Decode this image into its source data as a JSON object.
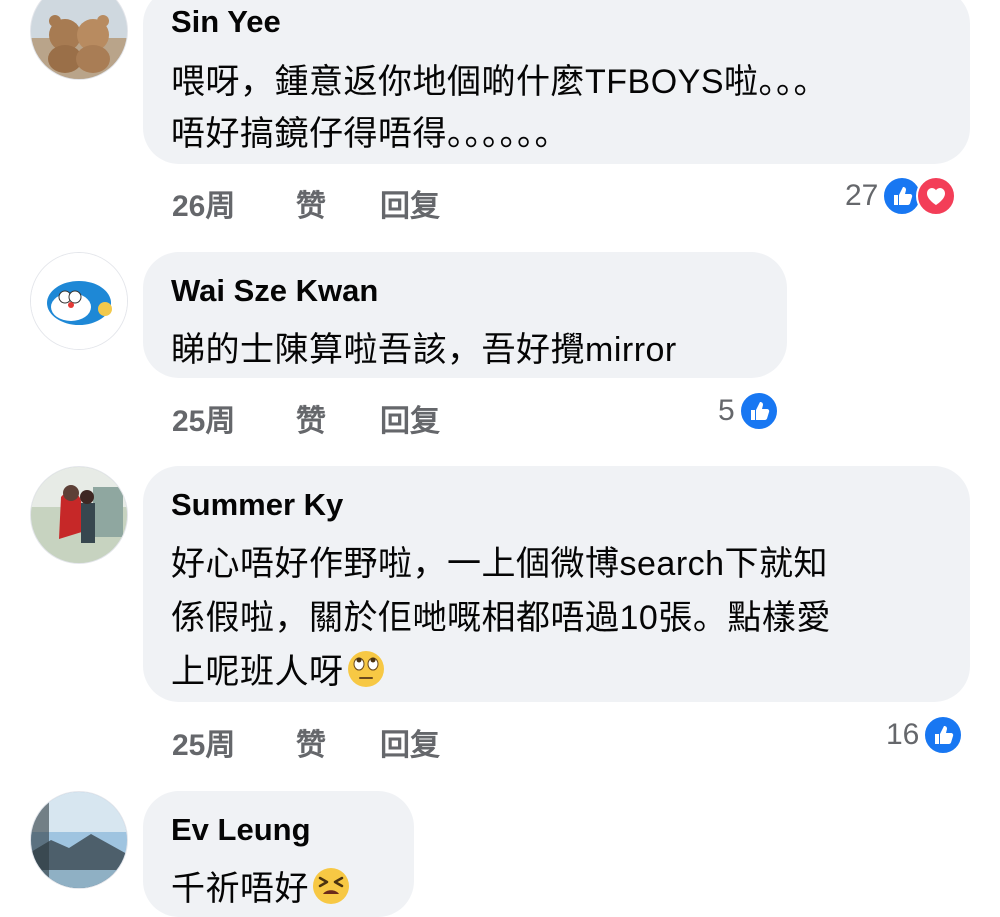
{
  "comments": [
    {
      "author": "Sin Yee",
      "lines": [
        "喂呀，鍾意返你地個啲什麼TFBOYS啦。。。",
        "唔好搞鏡仔得唔得。。。。。。"
      ],
      "time": "26周",
      "like_label": "赞",
      "reply_label": "回复",
      "reaction_count": "27",
      "reactions": [
        "like-icon",
        "love-icon"
      ],
      "avatar": "teddy-bears-avatar"
    },
    {
      "author": "Wai Sze Kwan",
      "lines": [
        "睇的士陳算啦吾該，吾好攪mirror"
      ],
      "time": "25周",
      "like_label": "赞",
      "reply_label": "回复",
      "reaction_count": "5",
      "reactions": [
        "like-icon"
      ],
      "avatar": "doraemon-avatar"
    },
    {
      "author": "Summer Ky",
      "lines": [
        "好心唔好作野啦，一上個微博search下就知",
        "係假啦，關於佢哋嘅相都唔過10張。點樣愛",
        "上呢班人呀"
      ],
      "time": "25周",
      "like_label": "赞",
      "reply_label": "回复",
      "reaction_count": "16",
      "reactions": [
        "like-icon"
      ],
      "avatar": "couple-photo-avatar",
      "trailing_emoji": "eye-roll-emoji"
    },
    {
      "author": "Ev Leung",
      "lines": [
        "千祈唔好"
      ],
      "avatar": "landscape-avatar",
      "trailing_emoji": "tired-face-emoji"
    }
  ],
  "colors": {
    "bubble_bg": "#f0f2f5",
    "meta_text": "#65676b",
    "like_blue": "#1877f2",
    "love_red": "#f33e58"
  }
}
